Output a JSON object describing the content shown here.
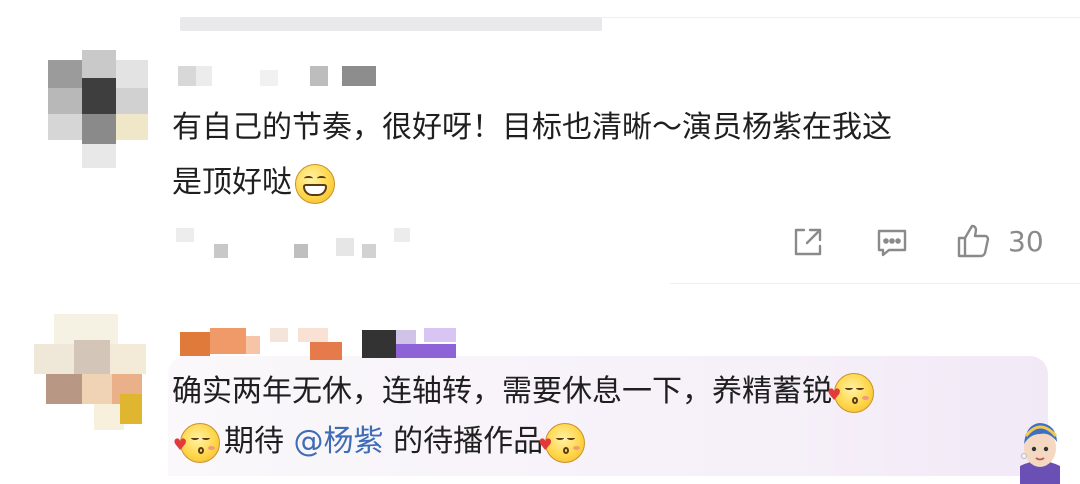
{
  "comments": [
    {
      "text_line1": "有自己的节奏，很好呀！目标也清晰～演员杨紫在我这",
      "text_line2": "是顶好哒",
      "emoji": "grinning-face-icon",
      "actions": {
        "share_icon": "share-icon",
        "comment_icon": "comment-icon",
        "like_icon": "thumbs-up-icon",
        "like_count": "30"
      }
    },
    {
      "text_line1": "确实两年无休，连轴转，需要休息一下，养精蓄锐",
      "line2_prefix": "期待",
      "mention": "@杨紫",
      "line2_suffix": "的待播作品",
      "emoji": "kissing-face-icon"
    }
  ],
  "colors": {
    "text": "#1f1f1f",
    "mention": "#3f6cb5",
    "action_gray": "#8a8a8a",
    "highlight_bg": "#f6f0f9"
  }
}
